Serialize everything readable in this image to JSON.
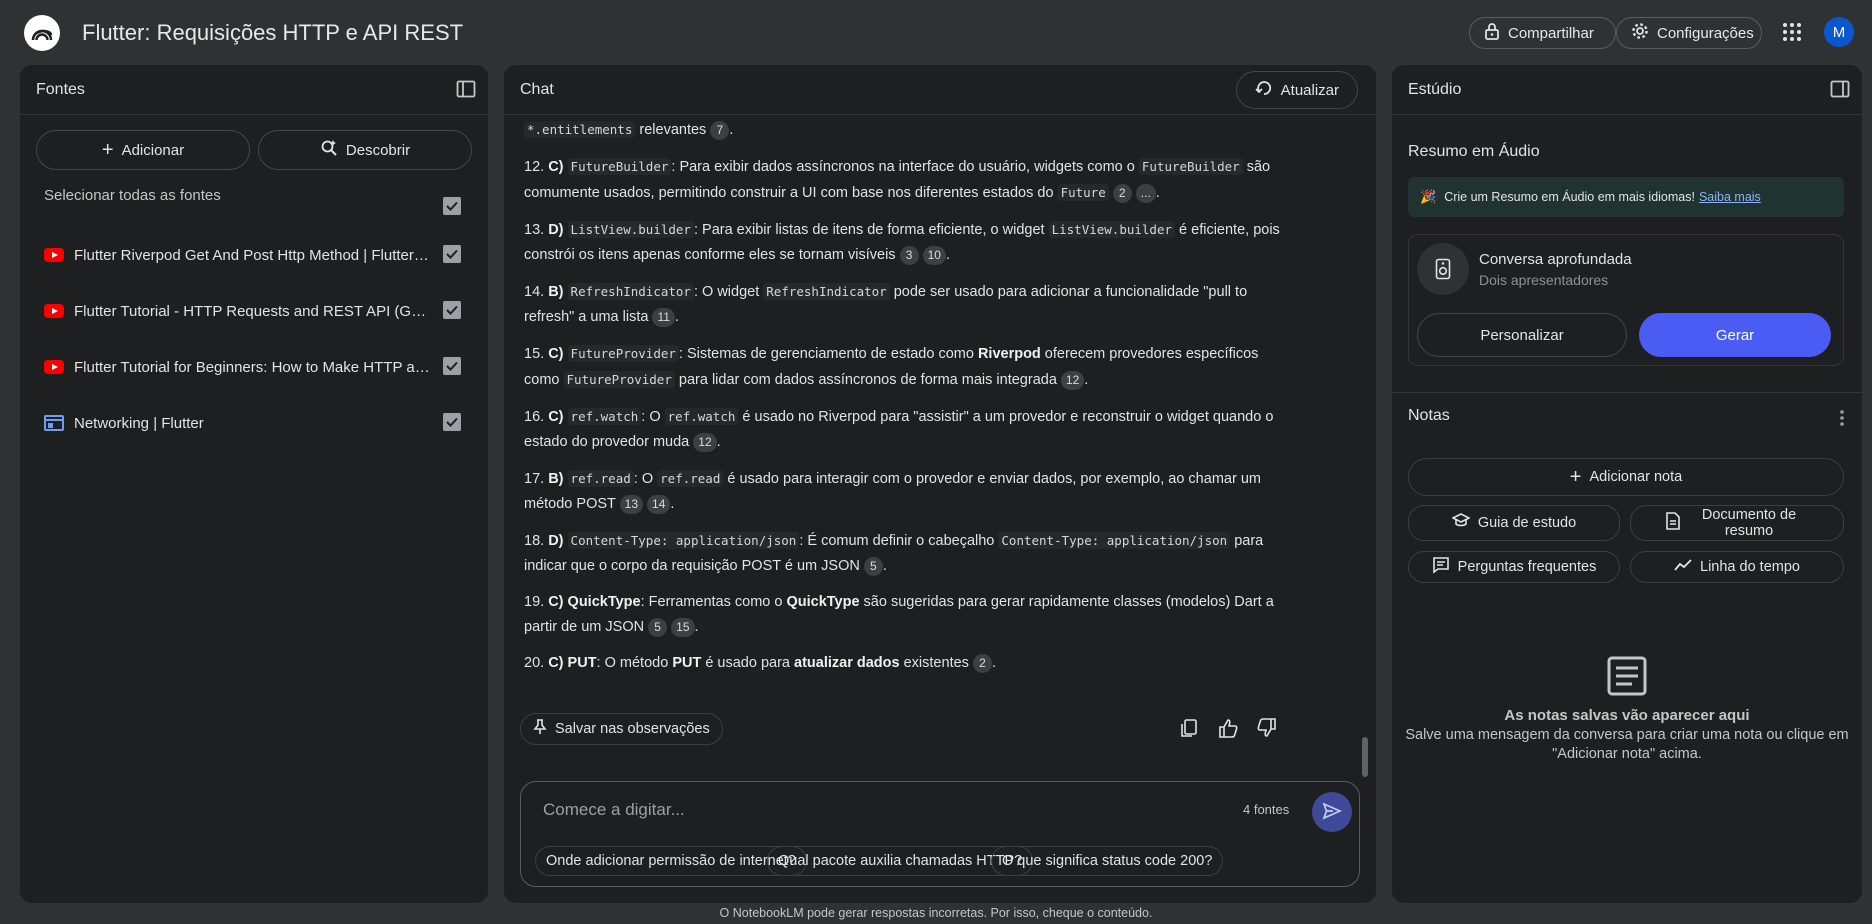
{
  "app": {
    "title": "Flutter: Requisições HTTP e API REST",
    "avatar_initial": "M"
  },
  "header": {
    "share_label": "Compartilhar",
    "settings_label": "Configurações"
  },
  "sources": {
    "title": "Fontes",
    "add_label": "Adicionar",
    "discover_label": "Descobrir",
    "select_all_label": "Selecionar todas as fontes",
    "items": [
      {
        "label": "Flutter Riverpod Get And Post Http Method | Flutter Ap...",
        "type": "youtube",
        "checked": true
      },
      {
        "label": "Flutter Tutorial - HTTP Requests and REST API (GET, P...",
        "type": "youtube",
        "checked": true
      },
      {
        "label": "Flutter Tutorial for Beginners: How to Make HTTP and ...",
        "type": "youtube",
        "checked": true
      },
      {
        "label": "Networking | Flutter",
        "type": "web",
        "checked": true
      }
    ]
  },
  "chat": {
    "title": "Chat",
    "refresh_label": "Atualizar",
    "partial_top": {
      "code": "*.entitlements",
      "text": " relevantes",
      "cites": [
        "7"
      ]
    },
    "answers": [
      {
        "num": "12.",
        "letter": "C)",
        "code": "FutureBuilder",
        "t1": ": Para exibir dados assíncronos na interface do usuário, widgets como o ",
        "code2": "FutureBuilder",
        "t2": " são comumente usados, permitindo construir a UI com base nos diferentes estados do ",
        "code3": "Future",
        "cites": [
          "2",
          "..."
        ]
      },
      {
        "num": "13.",
        "letter": "D)",
        "code": "ListView.builder",
        "t1": ": Para exibir listas de itens de forma eficiente, o widget ",
        "code2": "ListView.builder",
        "t2": " é eficiente, pois constrói os itens apenas conforme eles se tornam visíveis",
        "cites": [
          "3",
          "10"
        ]
      },
      {
        "num": "14.",
        "letter": "B)",
        "code": "RefreshIndicator",
        "t1": ": O widget ",
        "code2": "RefreshIndicator",
        "t2": " pode ser usado para adicionar a funcionalidade \"pull to refresh\" a uma lista",
        "cites": [
          "11"
        ]
      },
      {
        "num": "15.",
        "letter": "C)",
        "code": "FutureProvider",
        "t1": ": Sistemas de gerenciamento de estado como ",
        "bold": "Riverpod",
        "t2": " oferecem provedores específicos como ",
        "code2": "FutureProvider",
        "t3": " para lidar com dados assíncronos de forma mais integrada",
        "cites": [
          "12"
        ]
      },
      {
        "num": "16.",
        "letter": "C)",
        "code": "ref.watch",
        "t1": ": O ",
        "code2": "ref.watch",
        "t2": " é usado no Riverpod para \"assistir\" a um provedor e reconstruir o widget quando o estado do provedor muda",
        "cites": [
          "12"
        ]
      },
      {
        "num": "17.",
        "letter": "B)",
        "code": "ref.read",
        "t1": ": O ",
        "code2": "ref.read",
        "t2": " é usado para interagir com o provedor e enviar dados, por exemplo, ao chamar um método POST",
        "cites": [
          "13",
          "14"
        ]
      },
      {
        "num": "18.",
        "letter": "D)",
        "code": "Content-Type: application/json",
        "t1": ": É comum definir o cabeçalho ",
        "code2": "Content-Type: application/json",
        "t2": " para indicar que o corpo da requisição POST é um JSON",
        "cites": [
          "5"
        ]
      },
      {
        "num": "19.",
        "letter": "C)",
        "bold": "QuickType",
        "t1": ": Ferramentas como o ",
        "bold2": "QuickType",
        "t2": " são sugeridas para gerar rapidamente classes (modelos) Dart a partir de um JSON",
        "cites": [
          "5",
          "15"
        ]
      },
      {
        "num": "20.",
        "letter": "C)",
        "bold": "PUT",
        "t1": ": O método ",
        "bold2": "PUT",
        "t2": " é usado para ",
        "bold3": "atualizar dados",
        "t3": " existentes",
        "cites": [
          "2"
        ]
      }
    ],
    "save_note_label": "Salvar nas observações",
    "input_placeholder": "Comece a digitar...",
    "source_count": "4 fontes",
    "suggestions": [
      "Onde adicionar permissão de internet?",
      "Qual pacote auxilia chamadas HTTP?",
      "O que significa status code 200?"
    ]
  },
  "studio": {
    "title": "Estúdio",
    "audio_title": "Resumo em Áudio",
    "banner_text": "Crie um Resumo em Áudio em mais idiomas!",
    "banner_link": "Saiba mais",
    "deep_dive_title": "Conversa aprofundada",
    "deep_dive_sub": "Dois apresentadores",
    "customize_label": "Personalizar",
    "generate_label": "Gerar",
    "notes_title": "Notas",
    "add_note_label": "Adicionar nota",
    "study_guide_label": "Guia de estudo",
    "briefing_label": "Documento de resumo",
    "faq_label": "Perguntas frequentes",
    "timeline_label": "Linha do tempo",
    "empty_title": "As notas salvas vão aparecer aqui",
    "empty_desc": "Salve uma mensagem da conversa para criar uma nota ou clique em \"Adicionar nota\" acima."
  },
  "footer": {
    "disclaimer": "O NotebookLM pode gerar respostas incorretas. Por isso, cheque o conteúdo."
  },
  "colors": {
    "accent": "#4a5cf4",
    "panel": "#1e1f20",
    "background": "#303133",
    "banner": "#203331"
  }
}
